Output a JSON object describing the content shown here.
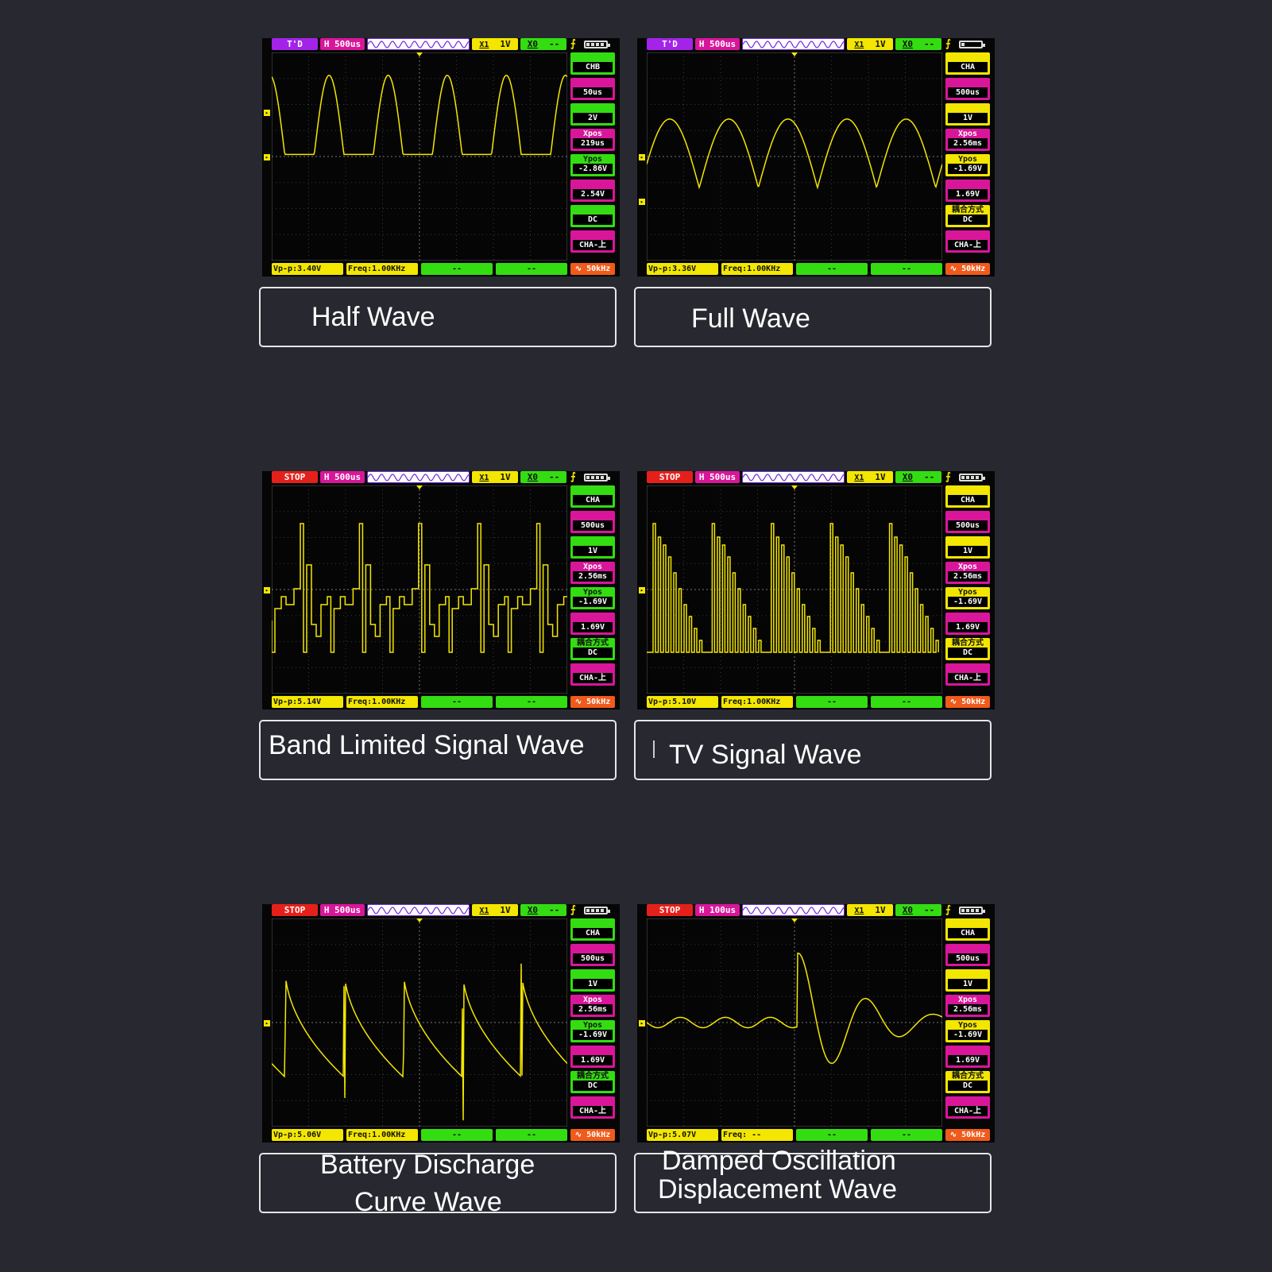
{
  "colors": {
    "background": "#272830",
    "trace": "#f3e600",
    "stop": "#e5201a",
    "td": "#a323e8",
    "magenta": "#d9169a",
    "green": "#33dd11",
    "yellow": "#f3e600",
    "orange": "#f05a1a"
  },
  "panels": [
    {
      "caption_lines": [
        "Half Wave"
      ],
      "mode": "T'D",
      "h": "H 500us",
      "x": "X1",
      "xv": "1V",
      "c": "X0",
      "cv": "--",
      "side": [
        {
          "lbl": "",
          "val": "CHB"
        },
        {
          "lbl": "",
          "val": "50us"
        },
        {
          "lbl": "",
          "val": "2V"
        },
        {
          "lbl": "Xpos",
          "val": "219us"
        },
        {
          "lbl": "Ypos",
          "val": "-2.86V"
        },
        {
          "lbl": "",
          "val": "2.54V"
        },
        {
          "lbl": "",
          "val": "DC"
        },
        {
          "lbl": "",
          "val": "CHA-上"
        }
      ],
      "vpp": "Vp-p:3.40V",
      "freq": "Freq:1.00KHz",
      "b3": "--",
      "b4": "--",
      "b5": "50kHz"
    },
    {
      "caption_lines": [
        "Full Wave"
      ],
      "mode": "T'D",
      "h": "H 500us",
      "x": "X1",
      "xv": "1V",
      "c": "X0",
      "cv": "--",
      "side": [
        {
          "lbl": "",
          "val": "CHA"
        },
        {
          "lbl": "",
          "val": "500us"
        },
        {
          "lbl": "",
          "val": "1V"
        },
        {
          "lbl": "Xpos",
          "val": "2.56ms"
        },
        {
          "lbl": "Ypos",
          "val": "-1.69V"
        },
        {
          "lbl": "",
          "val": "1.69V"
        },
        {
          "lbl": "耦合方式",
          "val": "DC"
        },
        {
          "lbl": "",
          "val": "CHA-上"
        }
      ],
      "vpp": "Vp-p:3.36V",
      "freq": "Freq:1.00KHz",
      "b3": "--",
      "b4": "--",
      "b5": "50kHz"
    },
    {
      "caption_lines": [
        "Band Limited Signal Wave"
      ],
      "mode": "STOP",
      "h": "H 500us",
      "x": "X1",
      "xv": "1V",
      "c": "X0",
      "cv": "--",
      "side": [
        {
          "lbl": "",
          "val": "CHA"
        },
        {
          "lbl": "",
          "val": "500us"
        },
        {
          "lbl": "",
          "val": "1V"
        },
        {
          "lbl": "Xpos",
          "val": "2.56ms"
        },
        {
          "lbl": "Ypos",
          "val": "-1.69V"
        },
        {
          "lbl": "",
          "val": "1.69V"
        },
        {
          "lbl": "耦合方式",
          "val": "DC"
        },
        {
          "lbl": "",
          "val": "CHA-上"
        }
      ],
      "vpp": "Vp-p:5.14V",
      "freq": "Freq:1.00KHz",
      "b3": "--",
      "b4": "--",
      "b5": "50kHz"
    },
    {
      "caption_lines": [
        "TV Signal Wave"
      ],
      "mode": "STOP",
      "h": "H 500us",
      "x": "X1",
      "xv": "1V",
      "c": "X0",
      "cv": "--",
      "side": [
        {
          "lbl": "",
          "val": "CHA"
        },
        {
          "lbl": "",
          "val": "500us"
        },
        {
          "lbl": "",
          "val": "1V"
        },
        {
          "lbl": "Xpos",
          "val": "2.56ms"
        },
        {
          "lbl": "Ypos",
          "val": "-1.69V"
        },
        {
          "lbl": "",
          "val": "1.69V"
        },
        {
          "lbl": "耦合方式",
          "val": "DC"
        },
        {
          "lbl": "",
          "val": "CHA-上"
        }
      ],
      "vpp": "Vp-p:5.10V",
      "freq": "Freq:1.00KHz",
      "b3": "--",
      "b4": "--",
      "b5": "50kHz"
    },
    {
      "caption_lines": [
        "Battery Discharge",
        "Curve Wave"
      ],
      "mode": "STOP",
      "h": "H 500us",
      "x": "X1",
      "xv": "1V",
      "c": "X0",
      "cv": "--",
      "side": [
        {
          "lbl": "",
          "val": "CHA"
        },
        {
          "lbl": "",
          "val": "500us"
        },
        {
          "lbl": "",
          "val": "1V"
        },
        {
          "lbl": "Xpos",
          "val": "2.56ms"
        },
        {
          "lbl": "Ypos",
          "val": "-1.69V"
        },
        {
          "lbl": "",
          "val": "1.69V"
        },
        {
          "lbl": "耦合方式",
          "val": "DC"
        },
        {
          "lbl": "",
          "val": "CHA-上"
        }
      ],
      "vpp": "Vp-p:5.06V",
      "freq": "Freq:1.00KHz",
      "b3": "--",
      "b4": "--",
      "b5": "50kHz"
    },
    {
      "caption_lines": [
        "Damped Oscillation",
        "Displacement Wave"
      ],
      "mode": "STOP",
      "h": "H 100us",
      "x": "X1",
      "xv": "1V",
      "c": "X0",
      "cv": "--",
      "side": [
        {
          "lbl": "",
          "val": "CHA"
        },
        {
          "lbl": "",
          "val": "500us"
        },
        {
          "lbl": "",
          "val": "1V"
        },
        {
          "lbl": "Xpos",
          "val": "2.56ms"
        },
        {
          "lbl": "Ypos",
          "val": "-1.69V"
        },
        {
          "lbl": "",
          "val": "1.69V"
        },
        {
          "lbl": "耦合方式",
          "val": "DC"
        },
        {
          "lbl": "",
          "val": "CHA-上"
        }
      ],
      "vpp": "Vp-p:5.07V",
      "freq": "Freq: --",
      "b3": "--",
      "b4": "--",
      "b5": "50kHz"
    }
  ]
}
